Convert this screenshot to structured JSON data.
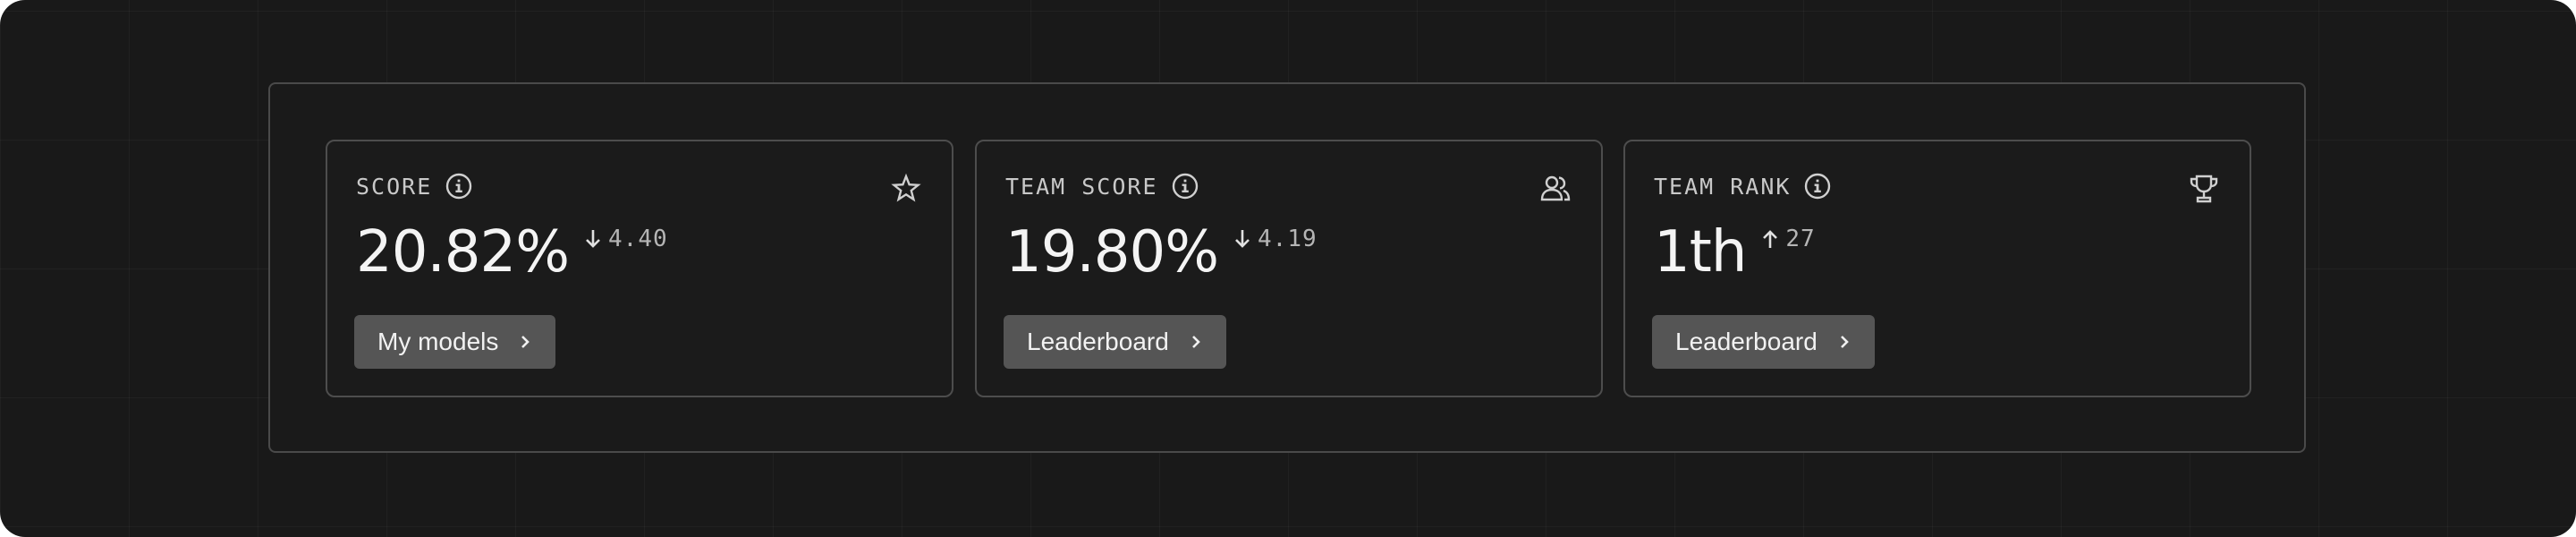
{
  "cards": [
    {
      "title": "SCORE",
      "value": "20.82%",
      "delta": "4.40",
      "delta_direction": "down",
      "corner_icon": "star-icon",
      "button_label": "My models"
    },
    {
      "title": "TEAM SCORE",
      "value": "19.80%",
      "delta": "4.19",
      "delta_direction": "down",
      "corner_icon": "team-icon",
      "button_label": "Leaderboard"
    },
    {
      "title": "TEAM RANK",
      "value": "1th",
      "delta": "27",
      "delta_direction": "up",
      "corner_icon": "trophy-icon",
      "button_label": "Leaderboard"
    }
  ],
  "colors": {
    "background": "#191919",
    "card_border": "#4d4d4d",
    "button_bg": "#555555",
    "text_primary": "#f4f4f4",
    "text_secondary": "#c9c9c9"
  }
}
